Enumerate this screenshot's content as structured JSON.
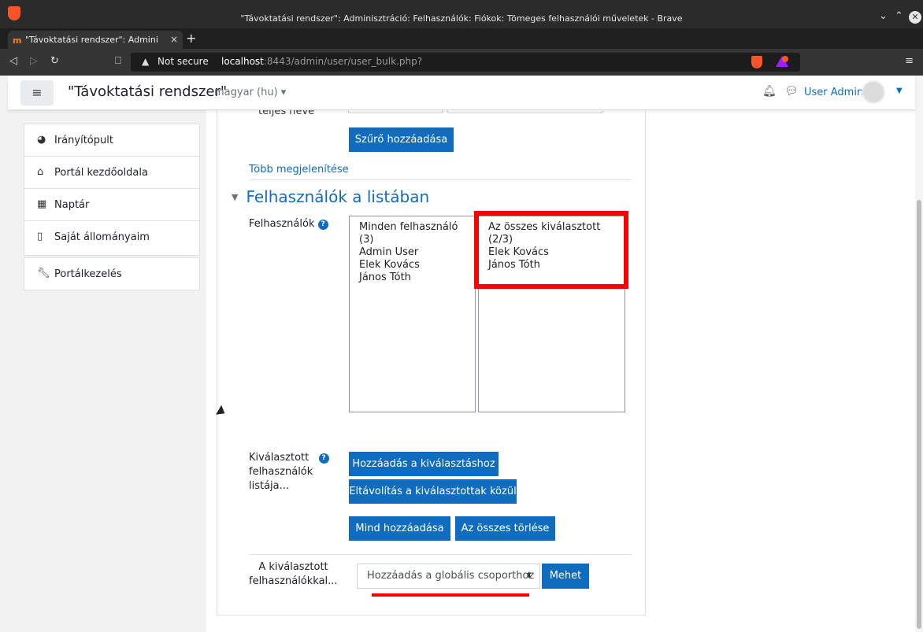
{
  "window": {
    "title": "\"Távoktatási rendszer\": Adminisztráció: Felhasználók: Fiókok: Tömeges felhasználói műveletek - Brave"
  },
  "tab": {
    "label": "\"Távoktatási rendszer\": Admini",
    "close": "×",
    "new": "+"
  },
  "address": {
    "security": "Not secure",
    "host": "localhost",
    "path": ":8443/admin/user/user_bulk.php?"
  },
  "header": {
    "menu_icon": "≡",
    "site_name": "\"Távoktatási rendszer\"",
    "language": "magyar (hu)",
    "user_name": "User Admin"
  },
  "sidebar": {
    "items": [
      {
        "label": "Irányítópult",
        "icon": "dashboard-icon"
      },
      {
        "label": "Portál kezdőoldala",
        "icon": "home-icon"
      },
      {
        "label": "Naptár",
        "icon": "calendar-icon"
      },
      {
        "label": "Saját állományaim",
        "icon": "file-icon"
      },
      {
        "label": "Portálkezelés",
        "icon": "wrench-icon"
      }
    ]
  },
  "filter": {
    "partial_label": "teljes neve",
    "add_filter_button": "Szűrő hozzáadása",
    "show_more_link": "Több megjelenítése"
  },
  "users_section": {
    "title": "Felhasználók a listában",
    "users_label": "Felhasználók",
    "available": [
      "Minden felhasználó (3)",
      "Admin User",
      "Elek Kovács",
      "János Tóth"
    ],
    "selected": [
      "Az összes kiválasztott (2/3)",
      "Elek Kovács",
      "János Tóth"
    ],
    "selected_list_label": [
      "Kiválasztott",
      "felhasználók",
      "listája..."
    ],
    "add_to_selection_button": "Hozzáadás a kiválasztáshoz",
    "remove_from_selection_button": "Eltávolítás a kiválasztottak közül",
    "add_all_button": "Mind hozzáadása",
    "remove_all_button": "Az összes törlése"
  },
  "action": {
    "label_lines": [
      "A kiválasztott",
      "felhasználókkal..."
    ],
    "selected_option": "Hozzáadás a globális csoporthoz",
    "go_button": "Mehet"
  },
  "colors": {
    "primary": "#0f6cbf",
    "highlight": "#ff0000"
  }
}
